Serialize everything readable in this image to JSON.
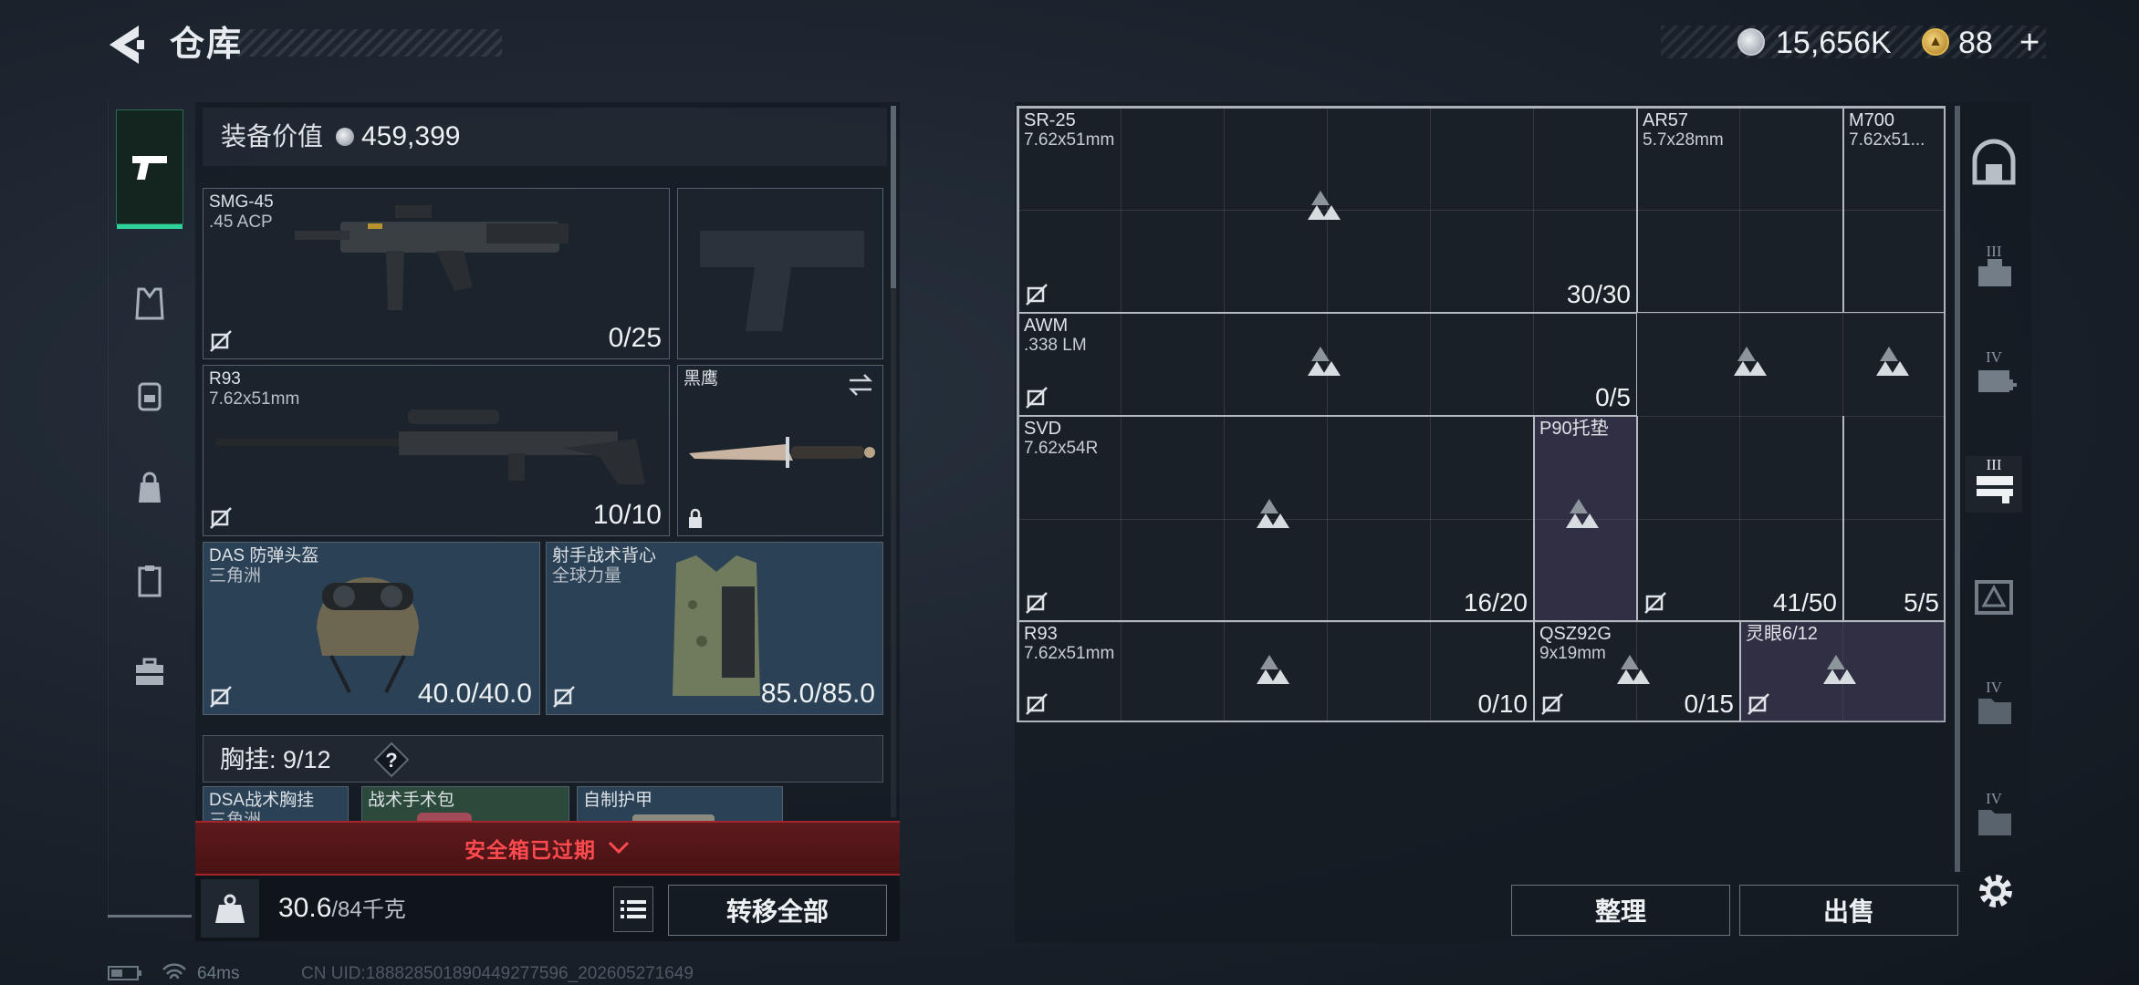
{
  "header": {
    "title": "仓库",
    "currency": "15,656K",
    "tokens": "88",
    "tokens_plus": "+"
  },
  "equipment": {
    "value_label": "装备价值",
    "value": "459,399",
    "slots": [
      {
        "name": "SMG-45",
        "sub": ".45 ACP",
        "count": "0/25"
      },
      {
        "name": "R93",
        "sub": "7.62x51mm",
        "count": "10/10"
      },
      {
        "name": "黑鹰",
        "sub": "",
        "count": ""
      },
      {
        "name": "DAS 防弹头盔",
        "sub": "三角洲",
        "count": "40.0/40.0"
      },
      {
        "name": "射手战术背心",
        "sub": "全球力量",
        "count": "85.0/85.0"
      }
    ],
    "chest_rig_label": "胸挂: 9/12",
    "chest_rig_help": "?",
    "rig_items": [
      {
        "name": "DSA战术胸挂",
        "sub": "三角洲"
      },
      {
        "name": "战术手术包"
      },
      {
        "name": "自制护甲"
      }
    ],
    "secure_box_text": "安全箱已过期",
    "weight_current": "30.6",
    "weight_max": "/84千克",
    "transfer_all": "转移全部"
  },
  "storage": {
    "items": [
      {
        "name": "SR-25",
        "sub": "7.62x51mm",
        "count": "30/30"
      },
      {
        "name": "AR57",
        "sub": "5.7x28mm",
        "count": ""
      },
      {
        "name": "M700",
        "sub": "7.62x51...",
        "count": ""
      },
      {
        "name": "AWM",
        "sub": ".338 LM",
        "count": "0/5"
      },
      {
        "name": "SVD",
        "sub": "7.62x54R",
        "count": "16/20"
      },
      {
        "name": "P90托垫",
        "sub": "",
        "count": ""
      },
      {
        "name": "",
        "sub": "",
        "count": "41/50"
      },
      {
        "name": "",
        "sub": "",
        "count": "5/5"
      },
      {
        "name": "R93",
        "sub": "7.62x51mm",
        "count": "0/10"
      },
      {
        "name": "QSZ92G",
        "sub": "9x19mm",
        "count": "0/15"
      },
      {
        "name": "灵眼6/12",
        "sub": "",
        "count": ""
      }
    ],
    "sort_label": "整理",
    "sell_label": "出售"
  },
  "right_rail": {
    "levels": [
      "III",
      "IV",
      "III",
      "IV",
      "IV"
    ]
  },
  "status": {
    "ping": "64ms",
    "uid": "CN UID:1888285018904492775​96_202605271649"
  },
  "colors": {
    "accent_green": "#2fd29a",
    "warning_red": "#ff4a4f",
    "rare_blue": "#2a4156",
    "epic_purple": "#50446e"
  }
}
